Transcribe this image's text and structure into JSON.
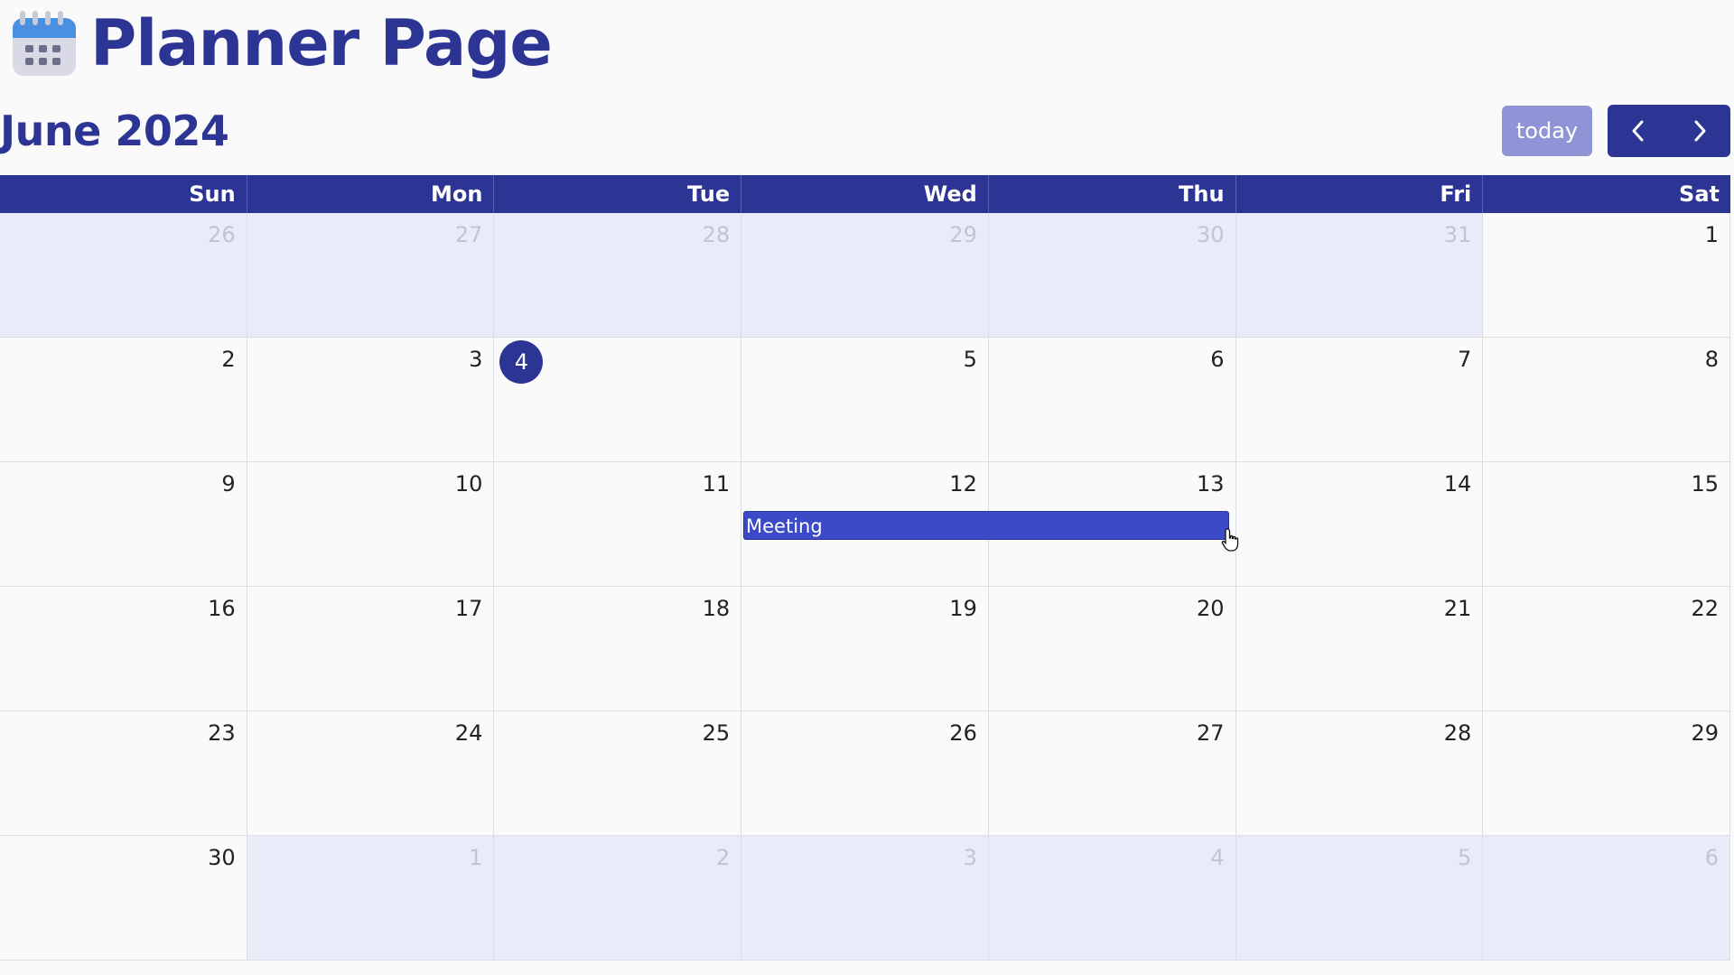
{
  "app": {
    "title": "Planner Page",
    "icon": "calendar-icon"
  },
  "toolbar": {
    "month_title": "June 2024",
    "today_label": "today",
    "prev_icon": "chevron-left-icon",
    "next_icon": "chevron-right-icon"
  },
  "calendar": {
    "weekdays": [
      "Sun",
      "Mon",
      "Tue",
      "Wed",
      "Thu",
      "Fri",
      "Sat"
    ],
    "today": "4",
    "weeks": [
      [
        {
          "n": "26",
          "other": true
        },
        {
          "n": "27",
          "other": true
        },
        {
          "n": "28",
          "other": true
        },
        {
          "n": "29",
          "other": true
        },
        {
          "n": "30",
          "other": true
        },
        {
          "n": "31",
          "other": true
        },
        {
          "n": "1",
          "other": false
        }
      ],
      [
        {
          "n": "2",
          "other": false
        },
        {
          "n": "3",
          "other": false
        },
        {
          "n": "4",
          "other": false,
          "today": true
        },
        {
          "n": "5",
          "other": false
        },
        {
          "n": "6",
          "other": false
        },
        {
          "n": "7",
          "other": false
        },
        {
          "n": "8",
          "other": false
        }
      ],
      [
        {
          "n": "9",
          "other": false
        },
        {
          "n": "10",
          "other": false
        },
        {
          "n": "11",
          "other": false
        },
        {
          "n": "12",
          "other": false
        },
        {
          "n": "13",
          "other": false
        },
        {
          "n": "14",
          "other": false
        },
        {
          "n": "15",
          "other": false
        }
      ],
      [
        {
          "n": "16",
          "other": false
        },
        {
          "n": "17",
          "other": false
        },
        {
          "n": "18",
          "other": false
        },
        {
          "n": "19",
          "other": false
        },
        {
          "n": "20",
          "other": false
        },
        {
          "n": "21",
          "other": false
        },
        {
          "n": "22",
          "other": false
        }
      ],
      [
        {
          "n": "23",
          "other": false
        },
        {
          "n": "24",
          "other": false
        },
        {
          "n": "25",
          "other": false
        },
        {
          "n": "26",
          "other": false
        },
        {
          "n": "27",
          "other": false
        },
        {
          "n": "28",
          "other": false
        },
        {
          "n": "29",
          "other": false
        }
      ],
      [
        {
          "n": "30",
          "other": false
        },
        {
          "n": "1",
          "other": true
        },
        {
          "n": "2",
          "other": true
        },
        {
          "n": "3",
          "other": true
        },
        {
          "n": "4",
          "other": true
        },
        {
          "n": "5",
          "other": true
        },
        {
          "n": "6",
          "other": true
        }
      ]
    ],
    "events": [
      {
        "title": "Meeting",
        "start": "12",
        "end": "13"
      }
    ]
  },
  "colors": {
    "primary": "#2c3494",
    "today_button": "#8f94d6",
    "event": "#3b4bc8",
    "other_month_bg": "#e9ebf8"
  }
}
